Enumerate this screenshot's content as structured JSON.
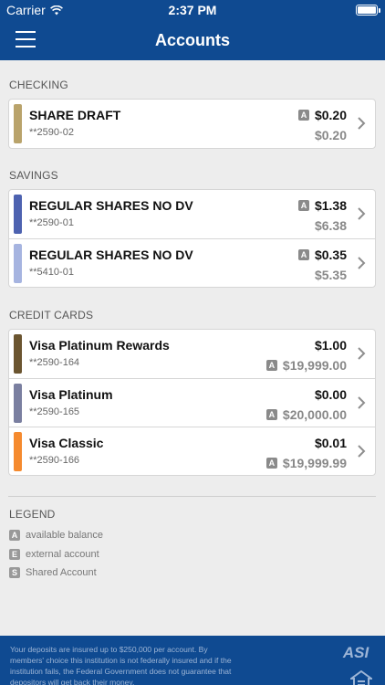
{
  "status_bar": {
    "carrier": "Carrier",
    "time": "2:37 PM"
  },
  "nav": {
    "title": "Accounts"
  },
  "sections": {
    "checking": "CHECKING",
    "savings": "SAVINGS",
    "credit_cards": "CREDIT CARDS"
  },
  "checking": [
    {
      "name": "SHARE DRAFT",
      "number": "**2590-02",
      "available": "$0.20",
      "balance": "$0.20",
      "badge": "A",
      "color": "#b9a36b"
    }
  ],
  "savings": [
    {
      "name": "REGULAR SHARES NO DV",
      "number": "**2590-01",
      "available": "$1.38",
      "balance": "$6.38",
      "badge": "A",
      "color": "#4d62b0"
    },
    {
      "name": "REGULAR SHARES NO DV",
      "number": "**5410-01",
      "available": "$0.35",
      "balance": "$5.35",
      "badge": "A",
      "color": "#a6b4e0"
    }
  ],
  "credit_cards": [
    {
      "name": "Visa Platinum Rewards",
      "number": "**2590-164",
      "amount": "$1.00",
      "available": "$19,999.00",
      "badge": "A",
      "color": "#6b5530"
    },
    {
      "name": "Visa Platinum",
      "number": "**2590-165",
      "amount": "$0.00",
      "available": "$20,000.00",
      "badge": "A",
      "color": "#7a7fa0"
    },
    {
      "name": "Visa Classic",
      "number": "**2590-166",
      "amount": "$0.01",
      "available": "$19,999.99",
      "badge": "A",
      "color": "#f58a2e"
    }
  ],
  "legend": {
    "title": "LEGEND",
    "items": [
      {
        "badge": "A",
        "label": "available balance"
      },
      {
        "badge": "E",
        "label": "external account"
      },
      {
        "badge": "S",
        "label": "Shared Account"
      }
    ]
  },
  "footer": {
    "disclaimer": "Your deposits are insured up to $250,000 per account. By members' choice this institution is not federally insured and if the institution fails, the Federal Government does not guarantee that depositors will get back their money.",
    "logo_text": "ASI"
  }
}
